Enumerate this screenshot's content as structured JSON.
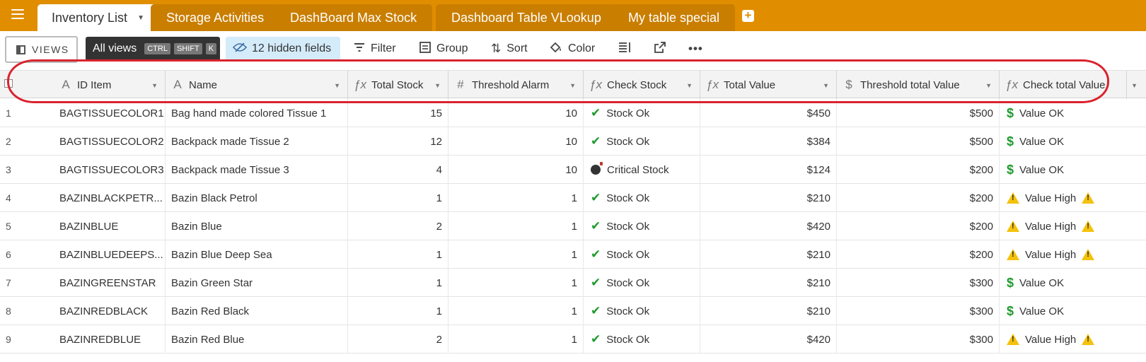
{
  "tabs": [
    {
      "label": "Inventory List",
      "active": true
    },
    {
      "label": "Storage Activities"
    },
    {
      "label": "DashBoard Max Stock"
    },
    {
      "label": "Dashboard Table VLookup"
    },
    {
      "label": "My table special"
    }
  ],
  "toolbar": {
    "views_label": "VIEWS",
    "all_views_label": "All views",
    "shortcut_keys": [
      "CTRL",
      "SHIFT",
      "K"
    ],
    "hidden_fields_label": "12 hidden fields",
    "filter_label": "Filter",
    "group_label": "Group",
    "sort_label": "Sort",
    "color_label": "Color"
  },
  "columns": [
    {
      "name": "ID Item",
      "icon": "text-field-icon"
    },
    {
      "name": "Name",
      "icon": "text-field-icon"
    },
    {
      "name": "Total Stock",
      "icon": "formula-icon"
    },
    {
      "name": "Threshold Alarm",
      "icon": "number-field-icon"
    },
    {
      "name": "Check Stock",
      "icon": "formula-icon"
    },
    {
      "name": "Total Value",
      "icon": "formula-icon"
    },
    {
      "name": "Threshold total Value",
      "icon": "currency-field-icon"
    },
    {
      "name": "Check total Value",
      "icon": "formula-icon"
    }
  ],
  "rows": [
    {
      "n": "1",
      "id": "BAGTISSUECOLOR1",
      "name": "Bag hand made colored Tissue 1",
      "stock": "15",
      "threshold": "10",
      "check": "Stock Ok",
      "check_icon": "checkmark-icon",
      "value": "$450",
      "thv": "$500",
      "cv": "Value OK",
      "cv_icon": "dollar-icon"
    },
    {
      "n": "2",
      "id": "BAGTISSUECOLOR2",
      "name": "Backpack made Tissue 2",
      "stock": "12",
      "threshold": "10",
      "check": "Stock Ok",
      "check_icon": "checkmark-icon",
      "value": "$384",
      "thv": "$500",
      "cv": "Value OK",
      "cv_icon": "dollar-icon"
    },
    {
      "n": "3",
      "id": "BAGTISSUECOLOR3",
      "name": "Backpack made Tissue 3",
      "stock": "4",
      "threshold": "10",
      "check": "Critical Stock",
      "check_icon": "bomb-icon",
      "value": "$124",
      "thv": "$200",
      "cv": "Value OK",
      "cv_icon": "dollar-icon"
    },
    {
      "n": "4",
      "id": "BAZINBLACKPETR...",
      "name": "Bazin Black Petrol",
      "stock": "1",
      "threshold": "1",
      "check": "Stock Ok",
      "check_icon": "checkmark-icon",
      "value": "$210",
      "thv": "$200",
      "cv": "Value High",
      "cv_icon": "warning-icon"
    },
    {
      "n": "5",
      "id": "BAZINBLUE",
      "name": "Bazin Blue",
      "stock": "2",
      "threshold": "1",
      "check": "Stock Ok",
      "check_icon": "checkmark-icon",
      "value": "$420",
      "thv": "$200",
      "cv": "Value High",
      "cv_icon": "warning-icon"
    },
    {
      "n": "6",
      "id": "BAZINBLUEDEEPS...",
      "name": "Bazin Blue Deep Sea",
      "stock": "1",
      "threshold": "1",
      "check": "Stock Ok",
      "check_icon": "checkmark-icon",
      "value": "$210",
      "thv": "$200",
      "cv": "Value High",
      "cv_icon": "warning-icon"
    },
    {
      "n": "7",
      "id": "BAZINGREENSTAR",
      "name": "Bazin Green Star",
      "stock": "1",
      "threshold": "1",
      "check": "Stock Ok",
      "check_icon": "checkmark-icon",
      "value": "$210",
      "thv": "$300",
      "cv": "Value OK",
      "cv_icon": "dollar-icon"
    },
    {
      "n": "8",
      "id": "BAZINREDBLACK",
      "name": "Bazin Red Black",
      "stock": "1",
      "threshold": "1",
      "check": "Stock Ok",
      "check_icon": "checkmark-icon",
      "value": "$210",
      "thv": "$300",
      "cv": "Value OK",
      "cv_icon": "dollar-icon"
    },
    {
      "n": "9",
      "id": "BAZINREDBLUE",
      "name": "Bazin Red Blue",
      "stock": "2",
      "threshold": "1",
      "check": "Stock Ok",
      "check_icon": "checkmark-icon",
      "value": "$420",
      "thv": "$300",
      "cv": "Value High",
      "cv_icon": "warning-icon"
    }
  ],
  "colors": {
    "accent": "#e08d00",
    "highlight": "#d9232e",
    "ok_green": "#1f9a2e",
    "warning_yellow": "#f4c20d"
  }
}
